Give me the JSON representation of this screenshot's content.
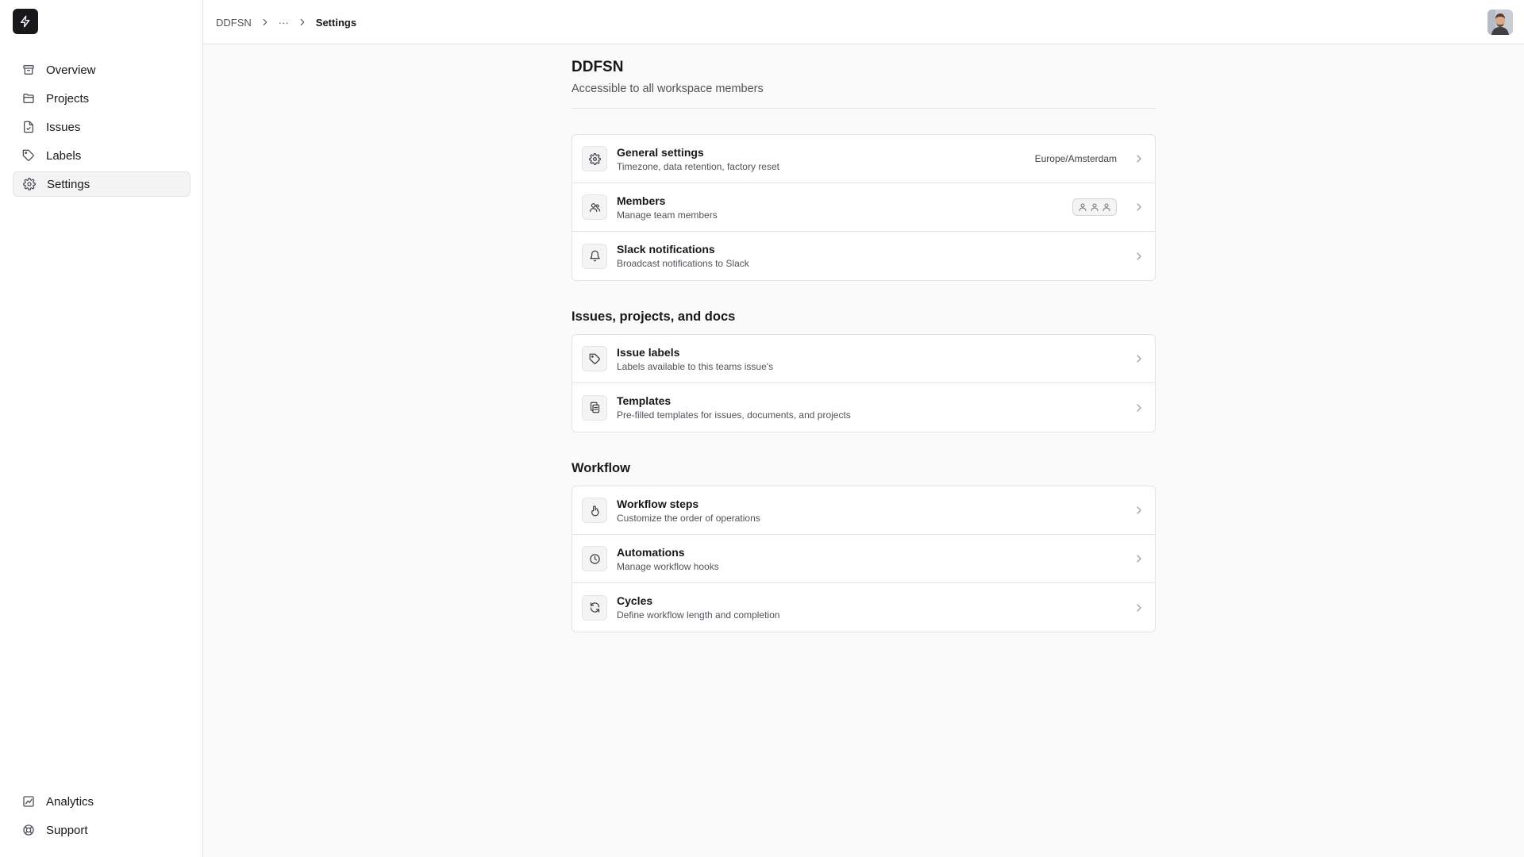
{
  "sidebar": {
    "items": [
      {
        "label": "Overview",
        "icon": "archive-icon"
      },
      {
        "label": "Projects",
        "icon": "folder-icon"
      },
      {
        "label": "Issues",
        "icon": "file-icon"
      },
      {
        "label": "Labels",
        "icon": "tag-icon"
      },
      {
        "label": "Settings",
        "icon": "gear-icon",
        "active": true
      }
    ],
    "bottom_items": [
      {
        "label": "Analytics",
        "icon": "chart-icon"
      },
      {
        "label": "Support",
        "icon": "lifebuoy-icon"
      }
    ]
  },
  "breadcrumb": {
    "root": "DDFSN",
    "ellipsis": "···",
    "current": "Settings"
  },
  "page": {
    "title": "DDFSN",
    "subtitle": "Accessible to all workspace members"
  },
  "general": {
    "settings": {
      "title": "General settings",
      "desc": "Timezone, data retention, factory reset",
      "meta": "Europe/Amsterdam"
    },
    "members": {
      "title": "Members",
      "desc": "Manage team members"
    },
    "slack": {
      "title": "Slack notifications",
      "desc": "Broadcast notifications to Slack"
    }
  },
  "issues_section": {
    "title": "Issues, projects, and docs",
    "labels": {
      "title": "Issue labels",
      "desc": "Labels available to this teams issue's"
    },
    "templates": {
      "title": "Templates",
      "desc": "Pre-filled templates for issues, documents, and projects"
    }
  },
  "workflow_section": {
    "title": "Workflow",
    "steps": {
      "title": "Workflow steps",
      "desc": "Customize the order of operations"
    },
    "automations": {
      "title": "Automations",
      "desc": "Manage workflow hooks"
    },
    "cycles": {
      "title": "Cycles",
      "desc": "Define workflow length and completion"
    }
  },
  "colors": {
    "accent": "#18181b",
    "background": "#fafafa",
    "border": "#e4e4e7",
    "muted_text": "#52525b"
  }
}
